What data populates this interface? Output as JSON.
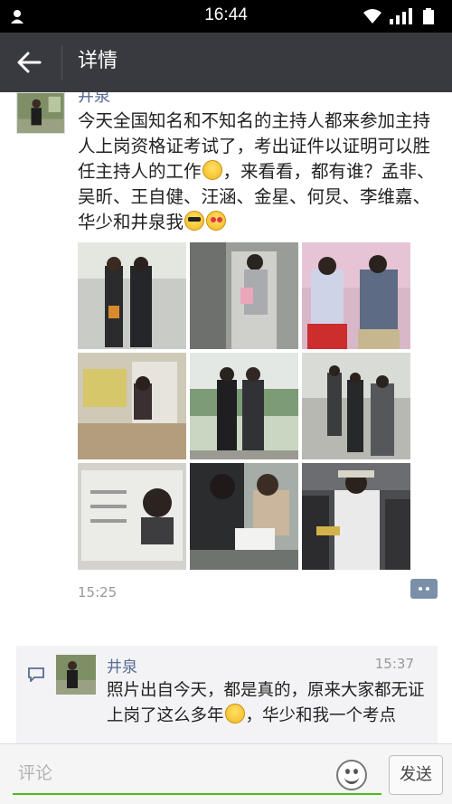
{
  "status_bar": {
    "time": "16:44",
    "icons": [
      "user-icon",
      "wifi-icon",
      "signal-icon",
      "battery-icon"
    ]
  },
  "header": {
    "title": "详情",
    "back_icon": "arrow-left-icon"
  },
  "post": {
    "author": "井泉",
    "text_parts": [
      "今天全国知名和不知名的主持人都来参加主持人上岗资格证考试了，考出证件以证明可以胜任主持人的工作",
      "，来看看，都有谁？孟非、吴昕、王自健、汪涵、金星、何炅、李维嘉、华少和井泉我"
    ],
    "emojis": [
      "laughing-tears-emoji",
      "sunglasses-emoji",
      "heart-eyes-emoji"
    ],
    "photos_count": 9,
    "time": "15:25",
    "comment_icon": "comment-dots-icon"
  },
  "comments": [
    {
      "author": "井泉",
      "time": "15:37",
      "text_parts": [
        "照片出自今天，都是真的，原来大家都无证上岗了这么多年",
        "，华少和我一个考点"
      ],
      "emoji": "laughing-tears-emoji"
    }
  ],
  "bottom_bar": {
    "placeholder": "评论",
    "send_label": "发送",
    "emoji_icon": "smiley-icon"
  },
  "colors": {
    "header_bg": "#393a3f",
    "link_name": "#576b95",
    "input_underline": "#45c01a",
    "comment_bg": "#f3f3f5"
  }
}
